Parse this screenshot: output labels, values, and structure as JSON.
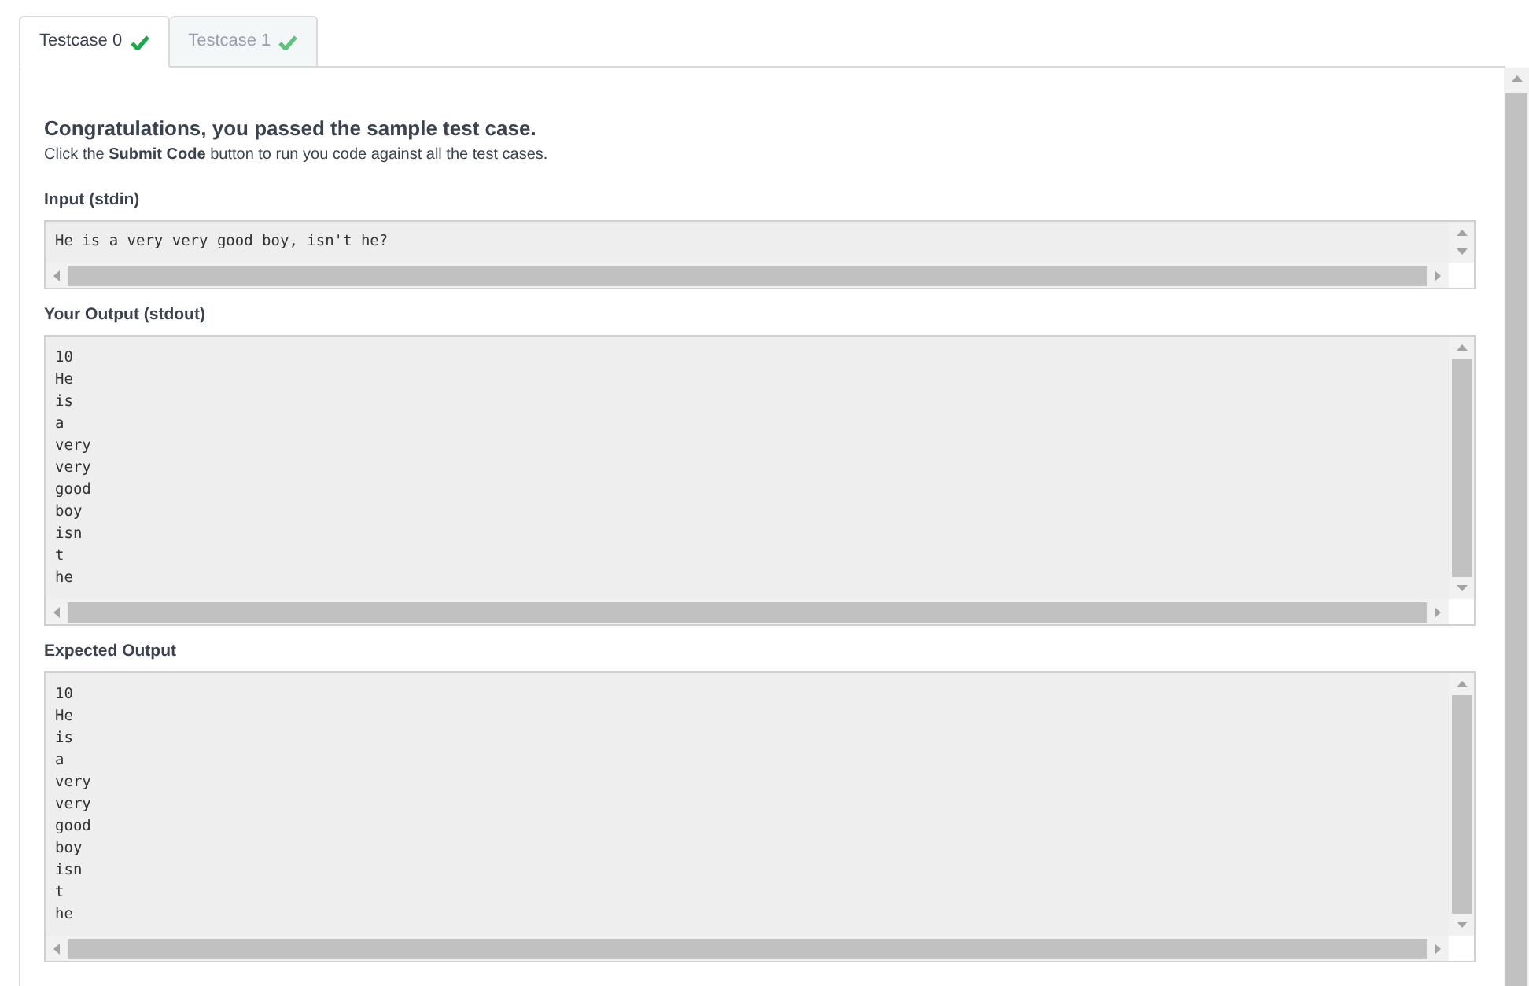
{
  "tabs": [
    {
      "label": "Testcase 0",
      "selected": true,
      "passed": true
    },
    {
      "label": "Testcase 1",
      "selected": false,
      "passed": true
    }
  ],
  "result": {
    "title": "Congratulations, you passed the sample test case.",
    "message": "Click the **Submit Code** button to run you code against all the test cases."
  },
  "sections": [
    {
      "label": "Input (stdin)",
      "text": "He is a very very good boy, isn't he?"
    },
    {
      "label": "Your Output (stdout)",
      "text": "10\nHe\nis\na\nvery\nvery\ngood\nboy\nisn\nt\nhe"
    },
    {
      "label": "Expected Output",
      "text": "10\nHe\nis\na\nvery\nvery\ngood\nboy\nisn\nt\nhe"
    }
  ]
}
